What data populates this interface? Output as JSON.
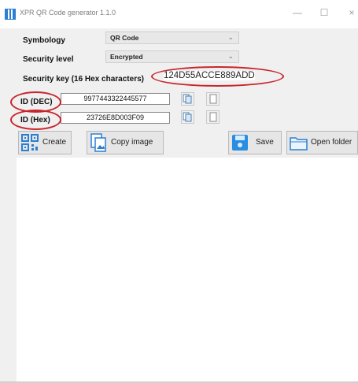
{
  "window": {
    "title": "XPR QR Code generator 1.1.0",
    "minimize": "—",
    "maximize": "☐",
    "close": "×"
  },
  "form": {
    "symbology_label": "Symbology",
    "symbology_value": "QR Code",
    "security_level_label": "Security level",
    "security_level_value": "Encrypted",
    "security_key_label": "Security key (16 Hex characters)",
    "security_key_value": "124D55ACCE889ADD",
    "id_dec_label": "ID (DEC)",
    "id_dec_value": "9977443322445577",
    "id_hex_label": "ID (Hex)",
    "id_hex_value": "23726E8D003F09"
  },
  "toolbar": {
    "create_label": "Create",
    "copy_image_label": "Copy image",
    "save_label": "Save",
    "open_folder_label": "Open folder"
  },
  "icons": {
    "app": "qr-code-icon",
    "copy": "copy-icon",
    "paste": "document-icon",
    "save": "floppy-icon",
    "folder": "folder-icon"
  },
  "colors": {
    "annotation": "#c9252c",
    "accent": "#2a7fd4"
  }
}
